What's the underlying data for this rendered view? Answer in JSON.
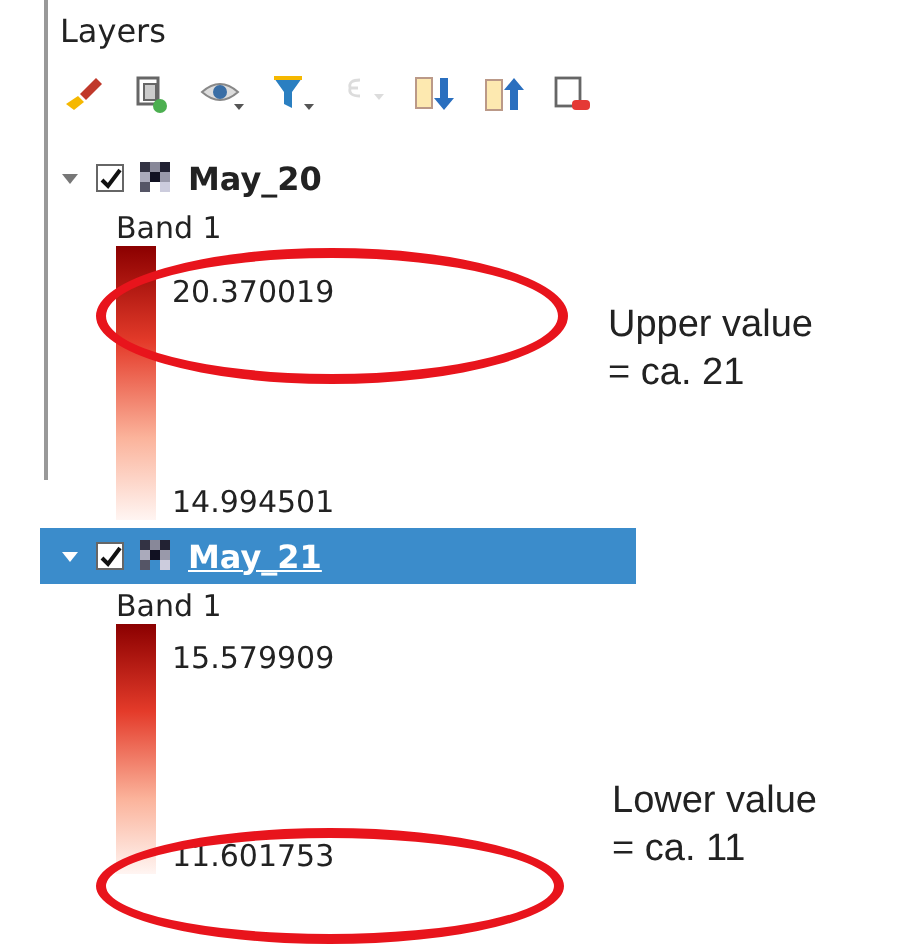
{
  "panel": {
    "title": "Layers",
    "toolbar": [
      {
        "kind": "style",
        "disabled": false
      },
      {
        "kind": "add-group",
        "disabled": false
      },
      {
        "kind": "visibility",
        "disabled": false
      },
      {
        "kind": "filter",
        "disabled": false
      },
      {
        "kind": "expression",
        "disabled": true
      },
      {
        "kind": "expand",
        "disabled": false
      },
      {
        "kind": "collapse",
        "disabled": false
      },
      {
        "kind": "remove",
        "disabled": false
      }
    ],
    "layers": [
      {
        "name": "May_20",
        "checked": true,
        "expanded": true,
        "selected": false,
        "band": "Band 1",
        "max": "20.370019",
        "min": "14.994501"
      },
      {
        "name": "May_21",
        "checked": true,
        "expanded": true,
        "selected": true,
        "band": "Band 1",
        "max": "15.579909",
        "min": "11.601753"
      }
    ]
  },
  "annotations": [
    {
      "lines": [
        "Upper value",
        "= ca. 21"
      ]
    },
    {
      "lines": [
        "Lower value",
        "= ca. 11"
      ]
    }
  ]
}
